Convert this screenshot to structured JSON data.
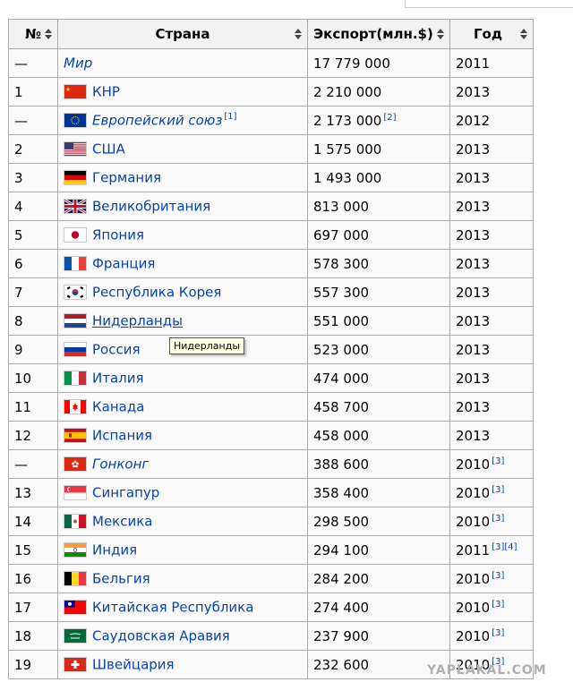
{
  "table": {
    "headers": {
      "num": "№",
      "country": "Страна",
      "export": "Экспорт(млн.$)",
      "year": "Год"
    },
    "rows": [
      {
        "num": "—",
        "country": "Мир",
        "export": "17 779 000",
        "year": "2011",
        "flag": "none",
        "italic": true
      },
      {
        "num": "1",
        "country": "КНР",
        "export": "2 210 000",
        "year": "2013",
        "flag": "china-flag-icon"
      },
      {
        "num": "—",
        "country": "Европейский союз",
        "country_ref": "[1]",
        "export": "2 173 000",
        "export_ref": "[2]",
        "year": "2012",
        "flag": "eu-flag-icon",
        "italic": true
      },
      {
        "num": "2",
        "country": "США",
        "export": "1 575 000",
        "year": "2013",
        "flag": "usa-flag-icon"
      },
      {
        "num": "3",
        "country": "Германия",
        "export": "1 493 000",
        "year": "2013",
        "flag": "germany-flag-icon"
      },
      {
        "num": "4",
        "country": "Великобритания",
        "export": "813 000",
        "year": "2013",
        "flag": "uk-flag-icon"
      },
      {
        "num": "5",
        "country": "Япония",
        "export": "697 000",
        "year": "2013",
        "flag": "japan-flag-icon"
      },
      {
        "num": "6",
        "country": "Франция",
        "export": "578 300",
        "year": "2013",
        "flag": "france-flag-icon"
      },
      {
        "num": "7",
        "country": "Республика Корея",
        "export": "557 300",
        "year": "2013",
        "flag": "korea-flag-icon"
      },
      {
        "num": "8",
        "country": "Нидерланды",
        "export": "551 000",
        "year": "2013",
        "flag": "netherlands-flag-icon",
        "hover": true
      },
      {
        "num": "9",
        "country": "Россия",
        "export": "523 000",
        "year": "2013",
        "flag": "russia-flag-icon"
      },
      {
        "num": "10",
        "country": "Италия",
        "export": "474 000",
        "year": "2013",
        "flag": "italy-flag-icon"
      },
      {
        "num": "11",
        "country": "Канада",
        "export": "458 700",
        "year": "2013",
        "flag": "canada-flag-icon"
      },
      {
        "num": "12",
        "country": "Испания",
        "export": "458 000",
        "year": "2013",
        "flag": "spain-flag-icon"
      },
      {
        "num": "—",
        "country": "Гонконг",
        "export": "388 600",
        "year": "2010",
        "year_ref": "[3]",
        "flag": "hongkong-flag-icon",
        "italic": true
      },
      {
        "num": "13",
        "country": "Сингапур",
        "export": "358 400",
        "year": "2010",
        "year_ref": "[3]",
        "flag": "singapore-flag-icon"
      },
      {
        "num": "14",
        "country": "Мексика",
        "export": "298 500",
        "year": "2010",
        "year_ref": "[3]",
        "flag": "mexico-flag-icon"
      },
      {
        "num": "15",
        "country": "Индия",
        "export": "294 100",
        "year": "2011",
        "year_ref": "[3][4]",
        "flag": "india-flag-icon"
      },
      {
        "num": "16",
        "country": "Бельгия",
        "export": "284 200",
        "year": "2010",
        "year_ref": "[3]",
        "flag": "belgium-flag-icon"
      },
      {
        "num": "17",
        "country": "Китайская Республика",
        "export": "274 400",
        "year": "2010",
        "year_ref": "[3]",
        "flag": "taiwan-flag-icon"
      },
      {
        "num": "18",
        "country": "Саудовская Аравия",
        "export": "237 900",
        "year": "2010",
        "year_ref": "[3]",
        "flag": "saudi-flag-icon"
      },
      {
        "num": "19",
        "country": "Швейцария",
        "export": "232 600",
        "year": "2010",
        "year_ref": "[3]",
        "flag": "switzerland-flag-icon"
      }
    ]
  },
  "tooltip": "Нидерланды",
  "watermark": "YAPLAKAL.COM",
  "colors": {
    "link": "#0645ad",
    "header_bg": "#f2f2f2",
    "cell_bg": "#f9f9f9",
    "border": "#aaaaaa"
  }
}
